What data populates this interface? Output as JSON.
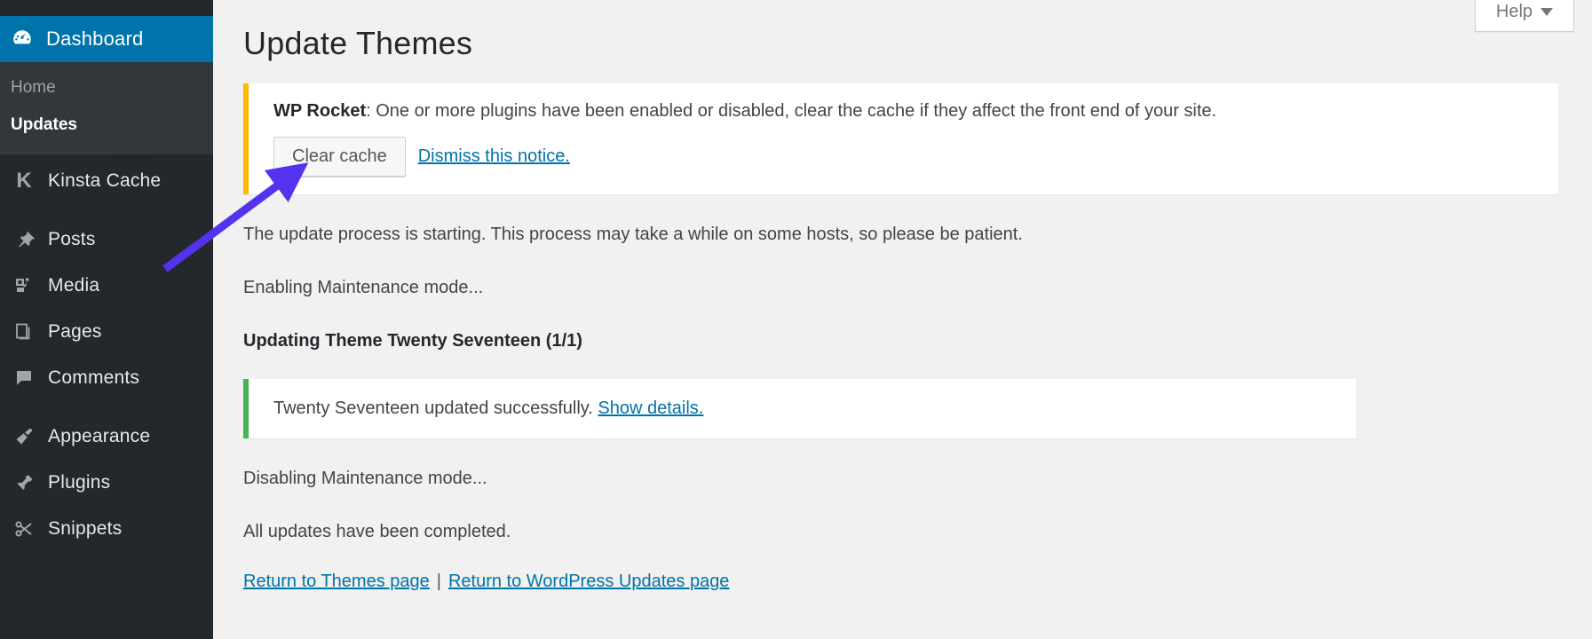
{
  "sidebar": {
    "dashboard": {
      "label": "Dashboard",
      "icon": "dashboard-icon"
    },
    "submenu": [
      {
        "label": "Home",
        "current": false
      },
      {
        "label": "Updates",
        "current": true
      }
    ],
    "items": [
      {
        "label": "Kinsta Cache",
        "icon": "kinsta-k-icon"
      },
      {
        "label": "Posts",
        "icon": "pin-icon"
      },
      {
        "label": "Media",
        "icon": "media-icon"
      },
      {
        "label": "Pages",
        "icon": "pages-icon"
      },
      {
        "label": "Comments",
        "icon": "comment-icon"
      },
      {
        "label": "Appearance",
        "icon": "paintbrush-icon"
      },
      {
        "label": "Plugins",
        "icon": "plug-icon"
      },
      {
        "label": "Snippets",
        "icon": "scissors-icon"
      }
    ]
  },
  "header": {
    "help_label": "Help"
  },
  "main": {
    "page_title": "Update Themes",
    "notice": {
      "plugin_name": "WP Rocket",
      "message": ": One or more plugins have been enabled or disabled, clear the cache if they affect the front end of your site.",
      "clear_cache_label": "Clear cache",
      "dismiss_label": "Dismiss this notice."
    },
    "log": {
      "line1": "The update process is starting. This process may take a while on some hosts, so please be patient.",
      "line2": "Enabling Maintenance mode...",
      "line3": "Updating Theme Twenty Seventeen (1/1)",
      "success_text": "Twenty Seventeen updated successfully. ",
      "success_link": "Show details.",
      "line4": "Disabling Maintenance mode...",
      "line5": "All updates have been completed."
    },
    "return_links": {
      "themes": "Return to Themes page",
      "separator": "|",
      "updates": "Return to WordPress Updates page"
    }
  },
  "colors": {
    "admin_blue": "#0073aa",
    "sidebar_dark": "#23282d",
    "sidebar_submenu": "#32373c",
    "warning": "#ffb900",
    "success": "#46b450",
    "link": "#0073aa",
    "annotation_arrow": "#5533ee"
  }
}
